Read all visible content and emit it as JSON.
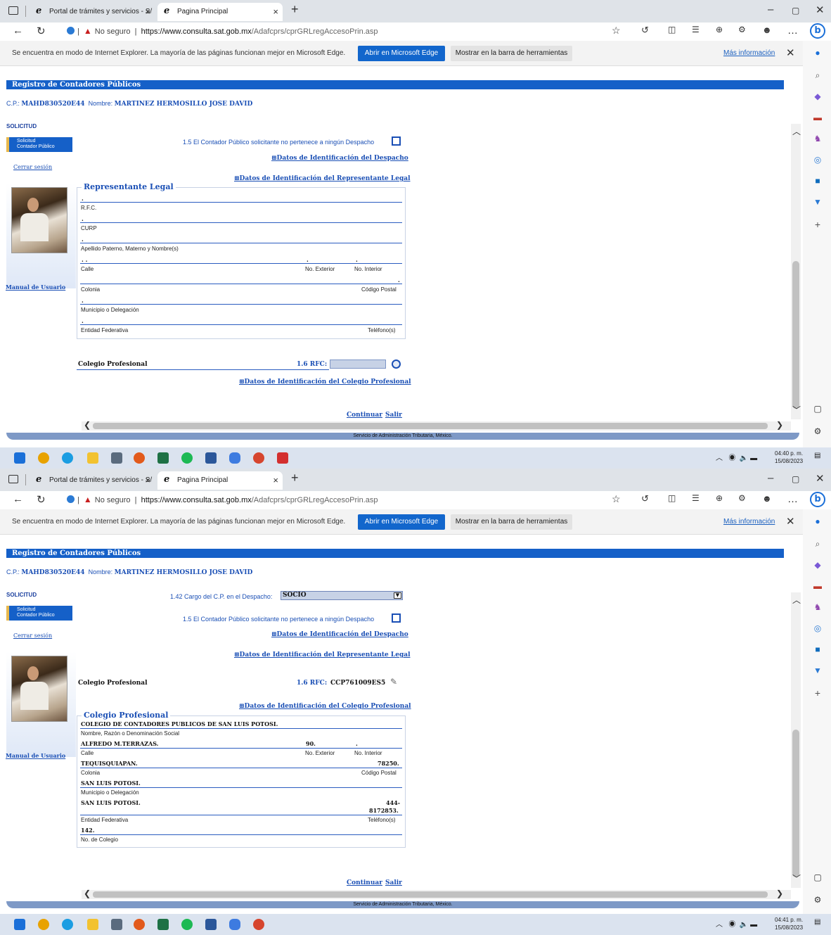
{
  "browser": {
    "tab1_title": "Portal de trámites y servicios - S/",
    "tab2_title": "Pagina Principal",
    "not_secure": "No seguro",
    "url_host": "https://www.consulta.sat.gob.mx",
    "url_path": "/Adafcprs/cprGRLregAccesoPrin.asp",
    "ie_message": "Se encuentra en modo de Internet Explorer. La mayoría de las páginas funcionan mejor en Microsoft Edge.",
    "open_edge": "Abrir en Microsoft Edge",
    "show_toolbar": "Mostrar en la barra de herramientas",
    "more_info": "Más información"
  },
  "page": {
    "header": "Registro de Contadores Públicos",
    "cp_label": "C.P.:",
    "cp_value": "MAHD830520E44",
    "name_label": "Nombre:",
    "name_value": "MARTINEZ HERMOSILLO JOSE DAVID",
    "solicitud": "SOLICITUD",
    "sol_btn_1": "Solicitud",
    "sol_btn_2": "Contador Público",
    "cerrar": "Cerrar sesión",
    "manual": "Manual de Usuario",
    "cargo_label": "1.42 Cargo del C.P. en el Despacho:",
    "cargo_value": "SOCIO",
    "no_despacho": "1.5 El Contador Público solicitante no pertenece a ningún Despacho",
    "link_despacho": "⊞Datos de Identificación del Despacho",
    "link_representante": "⊞Datos de Identificación del Representante Legal",
    "link_colegio": "⊞Datos de Identificación del Colegio Profesional",
    "colegio_label": "Colegio Profesional",
    "rfc_label": "1.6 RFC:",
    "rfc_value": "CCP761009ES5",
    "continuar": "Continuar",
    "salir": "Salir",
    "footer": "Servicio de Administración Tributaria, México."
  },
  "rep_legal": {
    "legend": "Representante Legal",
    "dot": ".",
    "dots2": ". .",
    "rfc": "R.F.C.",
    "curp": "CURP",
    "nombre": "Apellido Paterno, Materno y Nombre(s)",
    "calle": "Calle",
    "no_ext": "No. Exterior",
    "no_int": "No. Interior",
    "colonia": "Colonia",
    "cp": "Código Postal",
    "municipio": "Municipio o Delegación",
    "entidad": "Entidad Federativa",
    "telefono": "Teléfono(s)"
  },
  "colegio": {
    "legend": "Colegio Profesional",
    "razon_value": "COLEGIO DE CONTADORES PUBLICOS DE SAN LUIS POTOSI.",
    "razon_label": "Nombre, Razón o Denominación Social",
    "calle_value": "ALFREDO M.TERRAZAS.",
    "no_ext_value": "90.",
    "no_int_value": ".",
    "calle_label": "Calle",
    "no_ext_label": "No. Exterior",
    "no_int_label": "No. Interior",
    "colonia_value": "TEQUISQUIAPAN.",
    "cp_value": "78250.",
    "colonia_label": "Colonia",
    "cp_label": "Código Postal",
    "municipio_value": "SAN LUIS POTOSI.",
    "municipio_label": "Municipio o Delegación",
    "entidad_value": "SAN LUIS POTOSI.",
    "tel_value_1": "444-",
    "tel_value_2": "8172853.",
    "entidad_label": "Entidad Federativa",
    "tel_label": "Teléfono(s)",
    "no_colegio_value": "142.",
    "no_colegio_label": "No. de Colegio"
  },
  "taskbar": {
    "time1": "04:40 p. m.",
    "date1": "15/08/2023",
    "time2": "04:41 p. m.",
    "date2": "15/08/2023"
  },
  "colors": {
    "accent": "#1560c8",
    "link": "#1a4fb5",
    "edge_button": "#1266cc"
  },
  "icons": [
    "windows-icon",
    "chrome-icon",
    "edge-icon",
    "file-explorer-icon",
    "calculator-icon",
    "firefox-icon",
    "excel-icon",
    "spotify-icon",
    "word-icon",
    "shield-icon",
    "paint-icon",
    "pdf-icon"
  ]
}
